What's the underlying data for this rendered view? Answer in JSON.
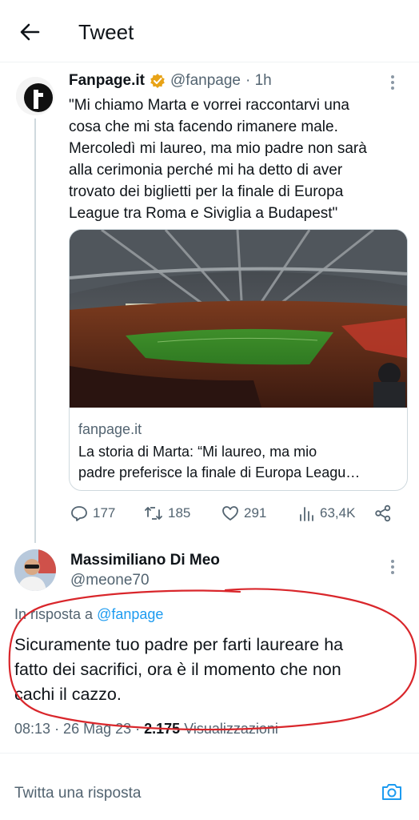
{
  "header": {
    "title": "Tweet"
  },
  "original_tweet": {
    "author_name": "Fanpage.it",
    "handle": "@fanpage",
    "time": "· 1h",
    "text_lines": [
      "\"Mi chiamo Marta e vorrei raccontarvi una",
      "cosa che mi sta facendo rimanere male.",
      "Mercoledì mi laureo, ma mio padre non sarà",
      "alla cerimonia perché mi ha detto di aver",
      "trovato dei biglietti per la finale di Europa",
      "League tra Roma e Siviglia a Budapest\""
    ],
    "card": {
      "domain": "fanpage.it",
      "title_lines": [
        "La storia di Marta: “Mi laureo, ma mio",
        "padre preferisce la finale di Europa Leagu…"
      ]
    },
    "stats": {
      "replies": "177",
      "retweets": "185",
      "likes": "291",
      "views": "63,4K"
    }
  },
  "reply": {
    "author_name": "Massimiliano Di Meo",
    "handle": "@meone70",
    "in_reply_prefix": "In risposta a",
    "in_reply_handle": "@fanpage",
    "text_lines": [
      "Sicuramente tuo padre per farti laureare ha",
      "fatto dei sacrifici, ora è il momento che non",
      "cachi il cazzo."
    ],
    "time": "08:13",
    "date": "· 26 Mag 23 ·",
    "view_count": "2.175",
    "views_label": "Visualizzazioni"
  },
  "composer": {
    "placeholder": "Twitta una risposta"
  },
  "colors": {
    "accent": "#1d9bf0",
    "annotation_red": "#d9262b",
    "verified": "#e8a317"
  },
  "icons": [
    "back-arrow-icon",
    "verified-badge-icon",
    "more-icon",
    "reply-icon",
    "retweet-icon",
    "like-icon",
    "views-icon",
    "share-icon",
    "camera-icon"
  ]
}
